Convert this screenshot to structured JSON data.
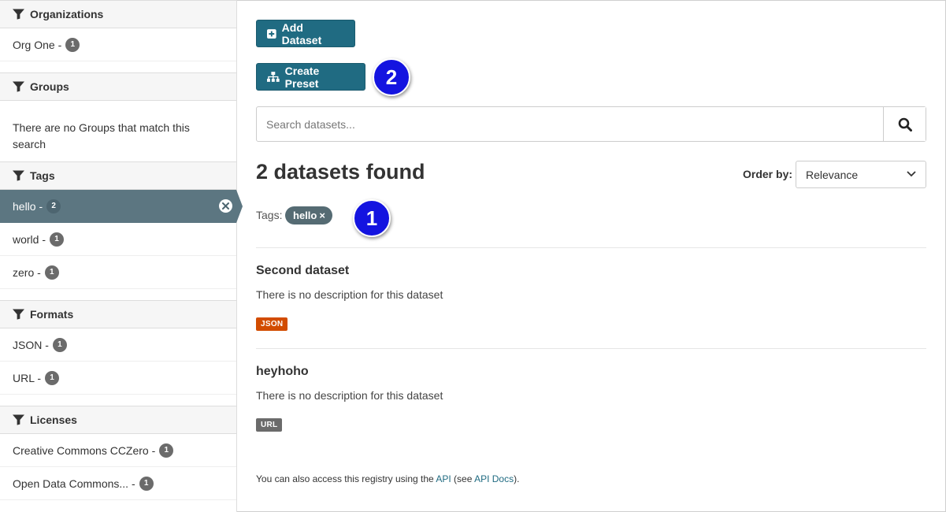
{
  "sidebar": {
    "organizations": {
      "heading": "Organizations",
      "items": [
        {
          "label": "Org One - ",
          "count": "1"
        }
      ]
    },
    "groups": {
      "heading": "Groups",
      "empty_text": "There are no Groups that match this search"
    },
    "tags": {
      "heading": "Tags",
      "items": [
        {
          "label": "hello - ",
          "count": "2",
          "active": true
        },
        {
          "label": "world - ",
          "count": "1"
        },
        {
          "label": "zero - ",
          "count": "1"
        }
      ]
    },
    "formats": {
      "heading": "Formats",
      "items": [
        {
          "label": "JSON - ",
          "count": "1"
        },
        {
          "label": "URL - ",
          "count": "1"
        }
      ]
    },
    "licenses": {
      "heading": "Licenses",
      "items": [
        {
          "label": "Creative Commons CCZero - ",
          "count": "1"
        },
        {
          "label": "Open Data Commons... - ",
          "count": "1"
        }
      ]
    }
  },
  "main": {
    "add_dataset_label": "Add Dataset",
    "create_preset_label": "Create Preset",
    "search_placeholder": "Search datasets...",
    "results_heading": "2 datasets found",
    "order_by_label": "Order by:",
    "order_by_value": "Relevance",
    "active_filters_label": "Tags:",
    "active_tag": "hello",
    "active_tag_remove": "×",
    "datasets": [
      {
        "title": "Second dataset",
        "description": "There is no description for this dataset",
        "format": "JSON",
        "format_color": "#d24c00"
      },
      {
        "title": "heyhoho",
        "description": "There is no description for this dataset",
        "format": "URL",
        "format_color": "#6b6b6b"
      }
    ],
    "footer": {
      "prefix": "You can also access this registry using the ",
      "api_link": "API",
      "middle": " (see ",
      "docs_link": "API Docs",
      "suffix": ")."
    }
  },
  "callouts": {
    "one": "1",
    "two": "2",
    "color": "#1414e0"
  },
  "colors": {
    "primary": "#206b82",
    "active_facet": "#5c7681"
  }
}
